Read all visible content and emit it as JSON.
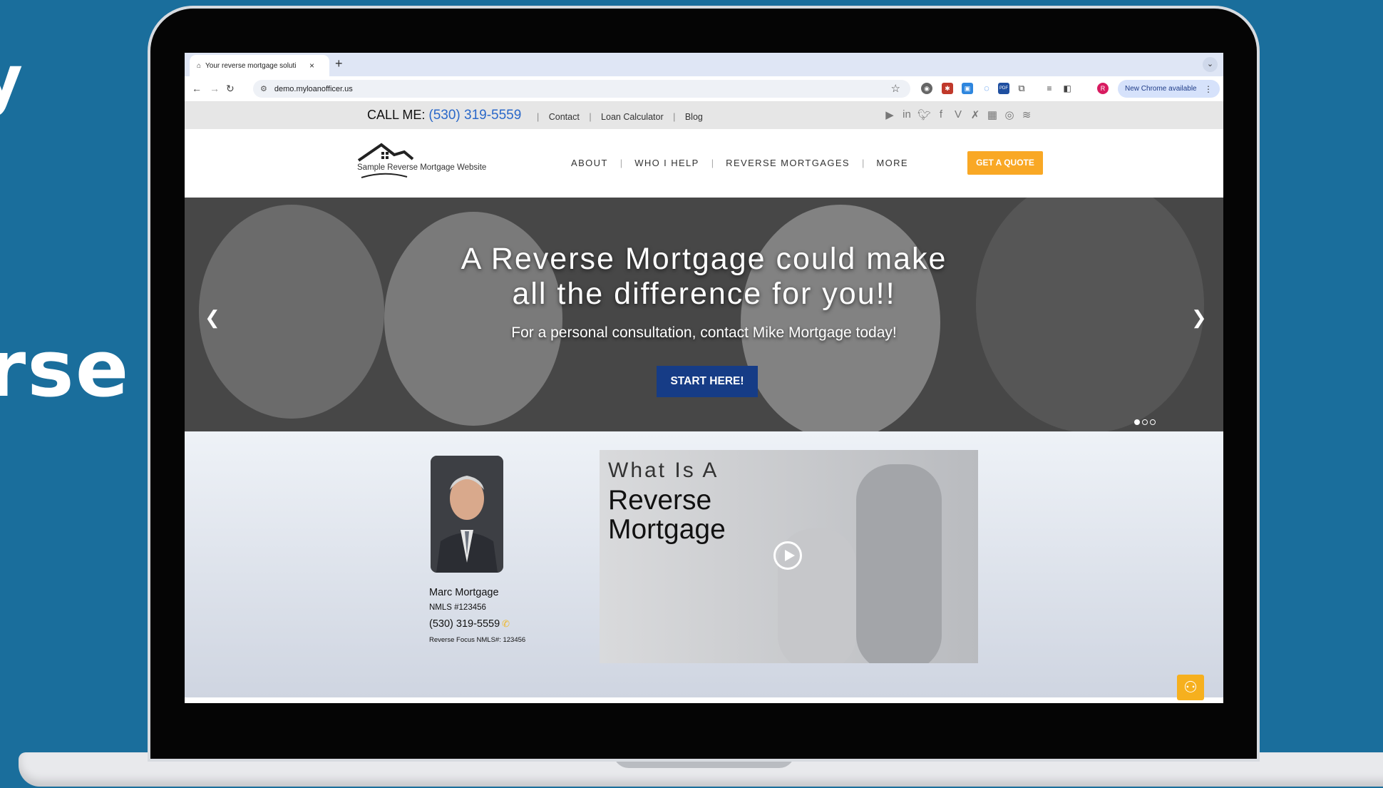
{
  "background": {
    "color": "#1a6e9c",
    "text_fragment_top": "y",
    "text_fragment_bottom": "rse"
  },
  "browser": {
    "tab_title": "Your reverse mortgage soluti",
    "tab_close_glyph": "×",
    "new_tab_glyph": "+",
    "url": "demo.myloanofficer.us",
    "update_label": "New Chrome available",
    "profile_initial": "R",
    "extension_icons": [
      "lens-icon",
      "extension-icon",
      "extension-icon",
      "extension-icon",
      "pdf-icon",
      "puzzle-icon"
    ],
    "pdf_label": "PDF"
  },
  "site": {
    "topbar": {
      "call_label": "CALL ME:",
      "phone": "(530) 319-5559",
      "links": [
        "Contact",
        "Loan Calculator",
        "Blog"
      ],
      "social_icons": [
        "youtube-icon",
        "linkedin-icon",
        "twitter-icon",
        "facebook-icon",
        "vimeo-icon",
        "x-icon",
        "instagram-alt-icon",
        "instagram-icon",
        "zillow-icon"
      ]
    },
    "header": {
      "logo_text": "Sample Reverse Mortgage Website",
      "nav": [
        "ABOUT",
        "WHO I HELP",
        "REVERSE MORTGAGES",
        "MORE"
      ],
      "quote_button": "GET A QUOTE",
      "accent": "#f9a825"
    },
    "hero": {
      "title_line1": "A Reverse Mortgage could make",
      "title_line2": "all the difference for you!!",
      "subtitle": "For a personal consultation, contact Mike Mortgage today!",
      "cta": "START HERE!",
      "cta_color": "#163c86",
      "slide_count": 3,
      "active_slide": 1
    },
    "agent": {
      "name": "Marc Mortgage",
      "nmls": "NMLS #123456",
      "phone": "(530) 319-5559",
      "company": "Reverse Focus NMLS#: 123456"
    },
    "video": {
      "line1": "What Is A",
      "line2": "Reverse",
      "line3": "Mortgage"
    }
  }
}
